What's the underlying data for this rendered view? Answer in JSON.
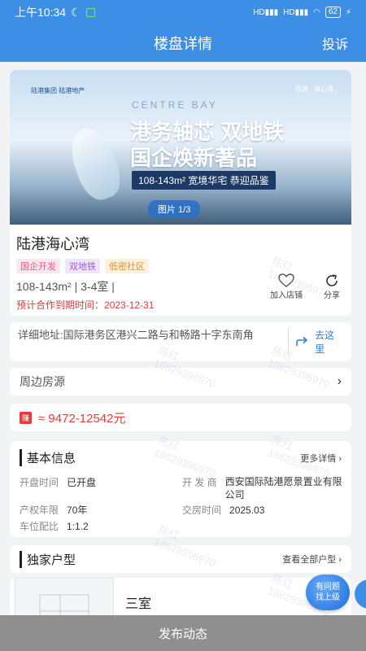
{
  "status": {
    "time": "上午10:34",
    "battery": "62"
  },
  "nav": {
    "title": "楼盘详情",
    "complain": "投诉"
  },
  "hero": {
    "logo_left": "陆港集团  陆港地产",
    "logo_right": "陆港 · 海心湾",
    "english": "CENTRE BAY",
    "headline1": "港务轴芯 双地铁",
    "headline2": "国企焕新著品",
    "subline": "108-143m² 宽境华宅 恭迎品鉴",
    "counter": "图片 1/3"
  },
  "info": {
    "name": "陆港海心湾",
    "tags": [
      "国企开发",
      "双地铁",
      "低密社区"
    ],
    "spec": "108-143m² | 3-4室 |",
    "expire_label": "预计合作到期时间：",
    "expire_date": "2023-12-31",
    "action_add": "加入店铺",
    "action_share": "分享"
  },
  "address": {
    "text": "详细地址:国际港务区港兴二路与和畅路十字东南角",
    "go": "去这里"
  },
  "nearby": {
    "label": "周边房源"
  },
  "price": {
    "badge": "赚",
    "text": "≈ 9472-12542元"
  },
  "basic": {
    "title": "基本信息",
    "more": "更多详情",
    "items": [
      {
        "k": "开盘时间",
        "v": "已开盘"
      },
      {
        "k": "开 发 商",
        "v": "西安国际陆港愿景置业有限公司"
      },
      {
        "k": "产权年限",
        "v": "70年"
      },
      {
        "k": "交房时间",
        "v": "2025.03"
      },
      {
        "k": "车位配比",
        "v": "1:1.2"
      }
    ]
  },
  "exclusive": {
    "title": "独家户型",
    "more": "查看全部户型"
  },
  "plan": {
    "title": "三室"
  },
  "float": {
    "line1": "有问题",
    "line2": "找上级"
  },
  "bottom": {
    "label": "发布动态"
  },
  "watermark": {
    "line1": "陈红",
    "line2": "18629396970"
  },
  "colors": {
    "primary": "#3d8fe6",
    "price": "#e23b3b"
  }
}
